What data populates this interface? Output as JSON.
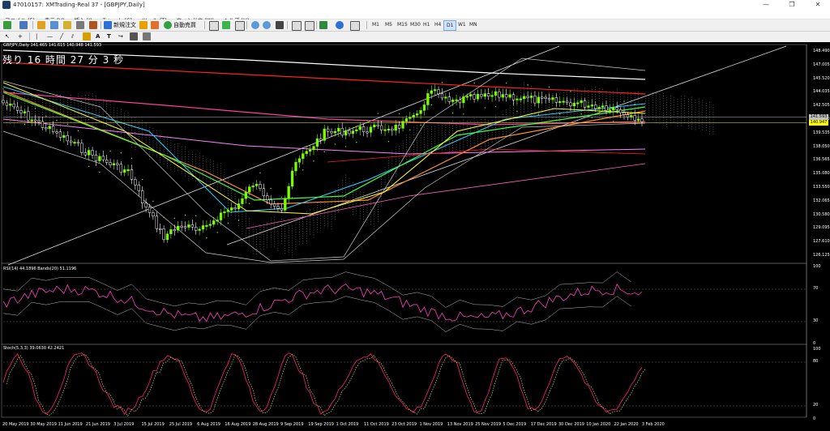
{
  "window": {
    "title": "47010157: XMTrading-Real 37 - [GBPJPY,Daily]",
    "minimize": "—",
    "maximize": "❐",
    "close": "✕"
  },
  "menu": [
    "ファイル (F)",
    "表示 (V)",
    "挿入 (I)",
    "チャート (C)",
    "ツール (T)",
    "ウィンドウ (W)",
    "ヘルプ (H)"
  ],
  "toolbar": {
    "new_order": "新規注文",
    "auto_trade": "自動売買",
    "timeframes": [
      "M1",
      "M5",
      "M15",
      "M30",
      "H1",
      "H4",
      "D1",
      "W1",
      "MN"
    ],
    "active_timeframe": "D1"
  },
  "drawing_tools": [
    "↖",
    "+",
    "|",
    "—",
    "╱",
    "⫽",
    "A",
    "T",
    "↪"
  ],
  "chart": {
    "symbol_info": "GBPJPY,Daily 141.465 141.615 140.948 141.593",
    "countdown": "残り 16 時間 27 分 3 秒",
    "bid_price": "141.593",
    "ask_price": "140.947",
    "price_axis": [
      "148.490",
      "147.005",
      "145.520",
      "144.035",
      "142.505",
      "141.020",
      "139.535",
      "138.050",
      "136.565",
      "135.080",
      "133.550",
      "132.065",
      "130.580",
      "129.095",
      "127.610",
      "126.125"
    ],
    "rsi_label": "RSI(14) 44.1896  Bands(20) 51.1196",
    "rsi_axis": [
      "70",
      "30",
      "0"
    ],
    "rsi_top": "100",
    "stoch_label": "Stoch(5,3,3) 39.0630 42.2421",
    "stoch_axis": [
      "100",
      "80",
      "20",
      "0"
    ],
    "dates": [
      "20 May 2019",
      "30 May 2019",
      "11 Jun 2019",
      "21 Jun 2019",
      "3 Jul 2019",
      "15 Jul 2019",
      "25 Jul 2019",
      "6 Aug 2019",
      "16 Aug 2019",
      "28 Aug 2019",
      "9 Sep 2019",
      "19 Sep 2019",
      "1 Oct 2019",
      "11 Oct 2019",
      "23 Oct 2019",
      "1 Nov 2019",
      "13 Nov 2019",
      "25 Nov 2019",
      "5 Dec 2019",
      "17 Dec 2019",
      "30 Dec 2019",
      "10 Jan 2020",
      "22 Jan 2020",
      "3 Feb 2020"
    ],
    "colors": {
      "bull": "#7CFC00",
      "bear": "#ffffff",
      "price_box_bid": "#c0c0c0",
      "price_box_ask": "#ffff00"
    }
  }
}
